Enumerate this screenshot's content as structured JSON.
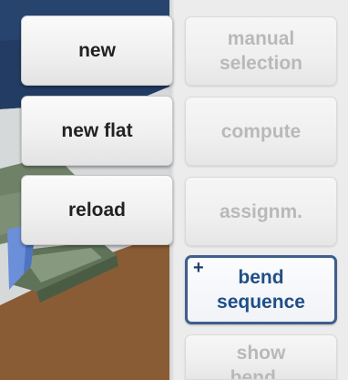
{
  "left_buttons": [
    {
      "label": "new"
    },
    {
      "label": "new flat"
    },
    {
      "label": "reload"
    }
  ],
  "right_buttons": {
    "manual_selection": [
      "manual",
      "selection"
    ],
    "compute": "compute",
    "assign": "assignm.",
    "bend_sequence": {
      "icon": "+",
      "lines": [
        "bend",
        "sequence"
      ]
    },
    "show_partial": [
      "show",
      "bend..."
    ]
  },
  "colors": {
    "enabled_text": "#222222",
    "disabled_text": "#b9b9b9",
    "selected_border": "#3f5f8d",
    "selected_text": "#1f4f86",
    "viewport_floor": "#8a5c35",
    "viewport_sky": "#203a61",
    "part_green": "#6d7f65",
    "part_blue": "#6b8fd8"
  }
}
